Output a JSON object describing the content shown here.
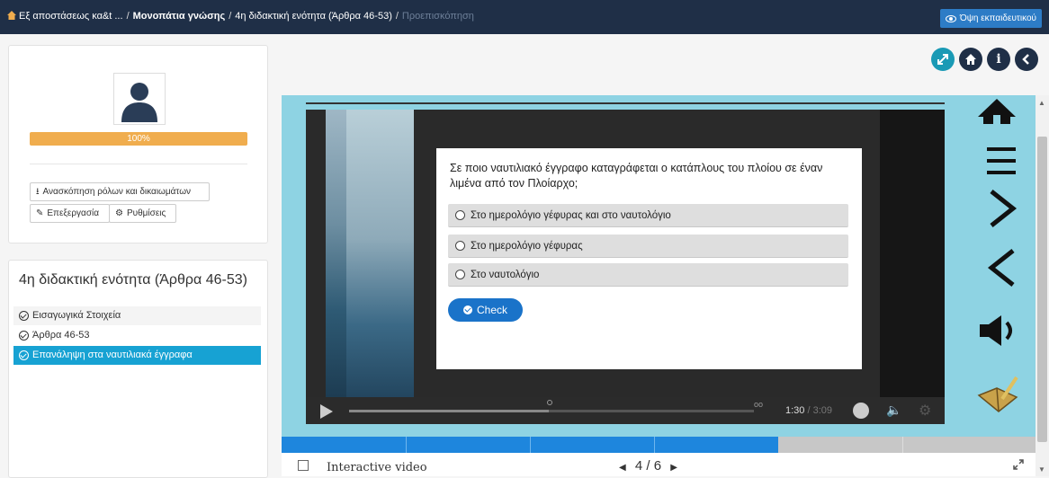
{
  "breadcrumb": {
    "items": [
      "Εξ αποστάσεως κα&t ...",
      "Μονοπάτια γνώσης",
      "4η διδακτική ενότητα (Άρθρα 46-53)"
    ],
    "current": "Προεπισκόπηση"
  },
  "header": {
    "teacher_view_label": "Όψη εκπαιδευτικού",
    "round_buttons": [
      "expand-icon",
      "home-icon",
      "info-icon",
      "back-icon"
    ]
  },
  "profile": {
    "progress_label": "100%",
    "progress": 1.0,
    "roles_button": "Ανασκόπηση ρόλων και δικαιωμάτων",
    "edit_button": "Επεξεργασία",
    "settings_button": "Ρυθμίσεις"
  },
  "lesson": {
    "title": "4η διδακτική ενότητα (Άρθρα 46-53)",
    "items": [
      {
        "label": "Εισαγωγικά Στοιχεία",
        "active": false
      },
      {
        "label": "Άρθρα 46-53",
        "active": false
      },
      {
        "label": "Επανάληψη στα ναυτιλιακά έγγραφα",
        "active": true
      }
    ]
  },
  "quiz": {
    "question": "Σε ποιο ναυτιλιακό έγγραφο καταγράφεται ο κατάπλους του πλοίου σε έναν λιμένα από τον Πλοίαρχο;",
    "options": [
      "Στο ημερολόγιο γέφυρας και στο ναυτολόγιο",
      "Στο ημερολόγιο γέφυρας",
      "Στο ναυτολόγιο"
    ],
    "check_label": "Check"
  },
  "video": {
    "current_time": "1:30",
    "separator": " / ",
    "duration": "3:09",
    "progress": 0.476
  },
  "footer": {
    "content_type": "Interactive video",
    "page_current": "4",
    "page_separator": "/",
    "page_total": "6"
  },
  "colors": {
    "topbar": "#1f2f47",
    "accent": "#1a73c9",
    "progress": "#f0ad4e",
    "active_item": "#17a2d3",
    "player_bg": "#8ed3e3"
  }
}
